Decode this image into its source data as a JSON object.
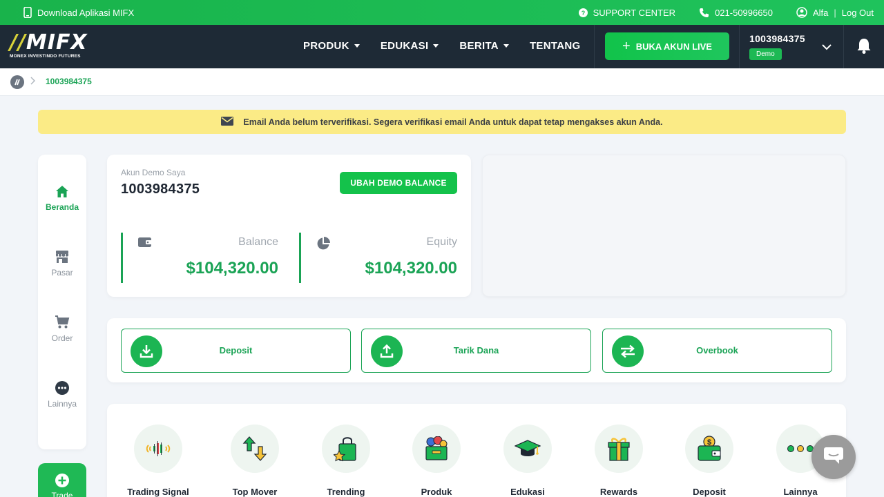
{
  "topbar": {
    "download_app": "Download Aplikasi MIFX",
    "support": "SUPPORT CENTER",
    "phone": "021-50996650",
    "user": "Alfa",
    "logout": "Log Out",
    "divider": "|"
  },
  "nav": {
    "logo": "MIFX",
    "logo_tagline": "MONEX INVESTINDO FUTURES",
    "menu": [
      "PRODUK",
      "EDUKASI",
      "BERITA",
      "TENTANG"
    ],
    "live_button": "BUKA AKUN LIVE",
    "account_number": "1003984375",
    "account_badge": "Demo"
  },
  "breadcrumb": {
    "current": "1003984375"
  },
  "alert": {
    "message": "Email Anda belum terverifikasi. Segera verifikasi email Anda untuk dapat tetap mengakses akun Anda."
  },
  "sidebar": {
    "items": [
      {
        "label": "Beranda",
        "icon": "home-icon",
        "active": true
      },
      {
        "label": "Pasar",
        "icon": "store-icon"
      },
      {
        "label": "Order",
        "icon": "cart-icon"
      },
      {
        "label": "Lainnya",
        "icon": "more-icon"
      }
    ],
    "trade_label": "Trade"
  },
  "account_card": {
    "label": "Akun Demo Saya",
    "number": "1003984375",
    "change_balance_button": "UBAH DEMO BALANCE",
    "balance_label": "Balance",
    "balance_value": "$104,320.00",
    "equity_label": "Equity",
    "equity_value": "$104,320.00"
  },
  "actions": [
    {
      "label": "Deposit",
      "icon": "download-icon"
    },
    {
      "label": "Tarik Dana",
      "icon": "upload-icon"
    },
    {
      "label": "Overbook",
      "icon": "transfer-icon"
    }
  ],
  "features": [
    {
      "label": "Trading Signal",
      "icon": "signal-icon"
    },
    {
      "label": "Top Mover",
      "icon": "top-mover-icon"
    },
    {
      "label": "Trending",
      "icon": "trending-bag-icon"
    },
    {
      "label": "Produk",
      "icon": "product-box-icon"
    },
    {
      "label": "Edukasi",
      "icon": "graduation-cap-icon"
    },
    {
      "label": "Rewards",
      "icon": "gift-icon"
    },
    {
      "label": "Deposit",
      "icon": "wallet-icon"
    },
    {
      "label": "Lainnya",
      "icon": "more-dots-icon"
    }
  ],
  "colors": {
    "brand_green": "#1aa355",
    "nav_dark": "#1e2a36",
    "alert_yellow": "#fbeb86"
  }
}
